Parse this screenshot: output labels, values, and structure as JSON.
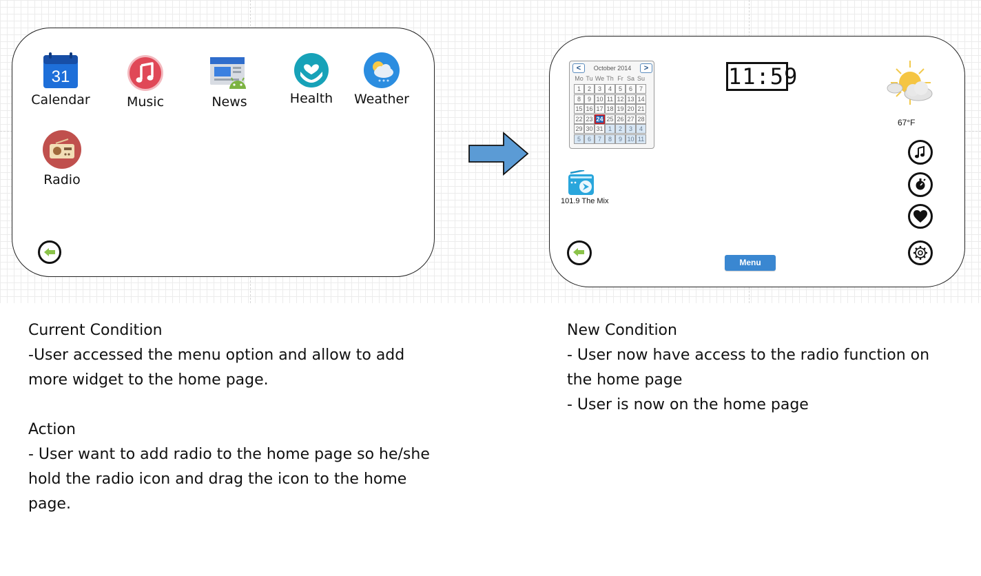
{
  "left_screen": {
    "apps": [
      {
        "label": "Calendar",
        "icon": "calendar-icon",
        "day": "31"
      },
      {
        "label": "Music",
        "icon": "music-icon"
      },
      {
        "label": "News",
        "icon": "news-icon"
      },
      {
        "label": "Health",
        "icon": "health-icon"
      },
      {
        "label": "Weather",
        "icon": "weather-icon"
      },
      {
        "label": "Radio",
        "icon": "radio-icon"
      }
    ]
  },
  "right_screen": {
    "calendar": {
      "prev": "<",
      "next": ">",
      "month": "October 2014",
      "weekdays": [
        "Mo",
        "Tu",
        "We",
        "Th",
        "Fr",
        "Sa",
        "Su"
      ],
      "weeks": [
        [
          "1",
          "2",
          "3",
          "4",
          "5",
          "6",
          "7"
        ],
        [
          "8",
          "9",
          "10",
          "11",
          "12",
          "13",
          "14"
        ],
        [
          "15",
          "16",
          "17",
          "18",
          "19",
          "20",
          "21"
        ],
        [
          "22",
          "23",
          "24",
          "25",
          "26",
          "27",
          "28"
        ],
        [
          "29",
          "30",
          "31",
          "1",
          "2",
          "3",
          "4"
        ],
        [
          "5",
          "6",
          "7",
          "8",
          "9",
          "10",
          "11"
        ]
      ],
      "today": "24"
    },
    "clock": "11:59",
    "temperature": "67°F",
    "radio_label": "101.9 The Mix",
    "menu_label": "Menu",
    "side_icons": [
      "music-note-icon",
      "timer-icon",
      "heart-icon",
      "gear-icon"
    ]
  },
  "current_condition": {
    "lines": [
      "Current Condition",
      "-User accessed the menu option and allow to add",
      "more widget to the home page."
    ]
  },
  "action": {
    "lines": [
      "Action",
      "- User want to add radio to the home page so he/she",
      "hold the radio icon and drag the icon to the home",
      "page."
    ]
  },
  "new_condition": {
    "lines": [
      "New Condition",
      "- User now have access to the radio function on",
      "the home page",
      "- User is now on the home page"
    ]
  },
  "colors": {
    "arrow_fill": "#5b9bd5",
    "menu_button": "#3a87d1",
    "back_arrow": "#8bc34a"
  }
}
